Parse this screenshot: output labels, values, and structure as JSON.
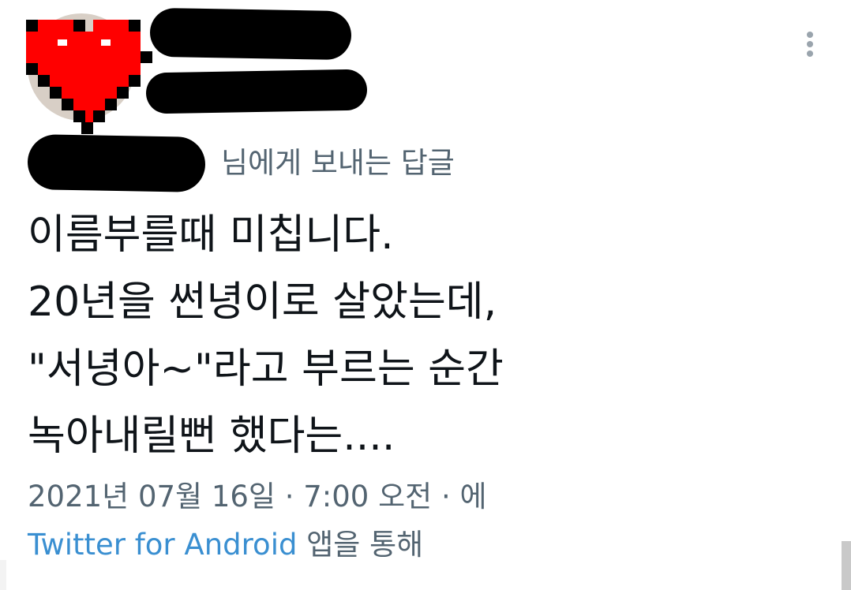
{
  "tweet": {
    "replying_to_suffix": "님에게 보내는 답글",
    "text_lines": [
      "이름부를때 미칩니다.",
      "20년을 썬녕이로 살았는데,",
      "\"서녕아~\"라고 부르는 순간",
      "녹아내릴뻔 했다는...."
    ],
    "timestamp": "2021년 07월 16일 · 7:00 오전 · 에",
    "source_app": "Twitter for Android",
    "source_suffix": " 앱을 통해"
  },
  "icons": {
    "avatar": "pixel-heart-icon",
    "more": "more-vertical-icon"
  },
  "colors": {
    "heart": "#ff0000",
    "link": "#3a8fd1",
    "secondary_text": "#536471"
  }
}
